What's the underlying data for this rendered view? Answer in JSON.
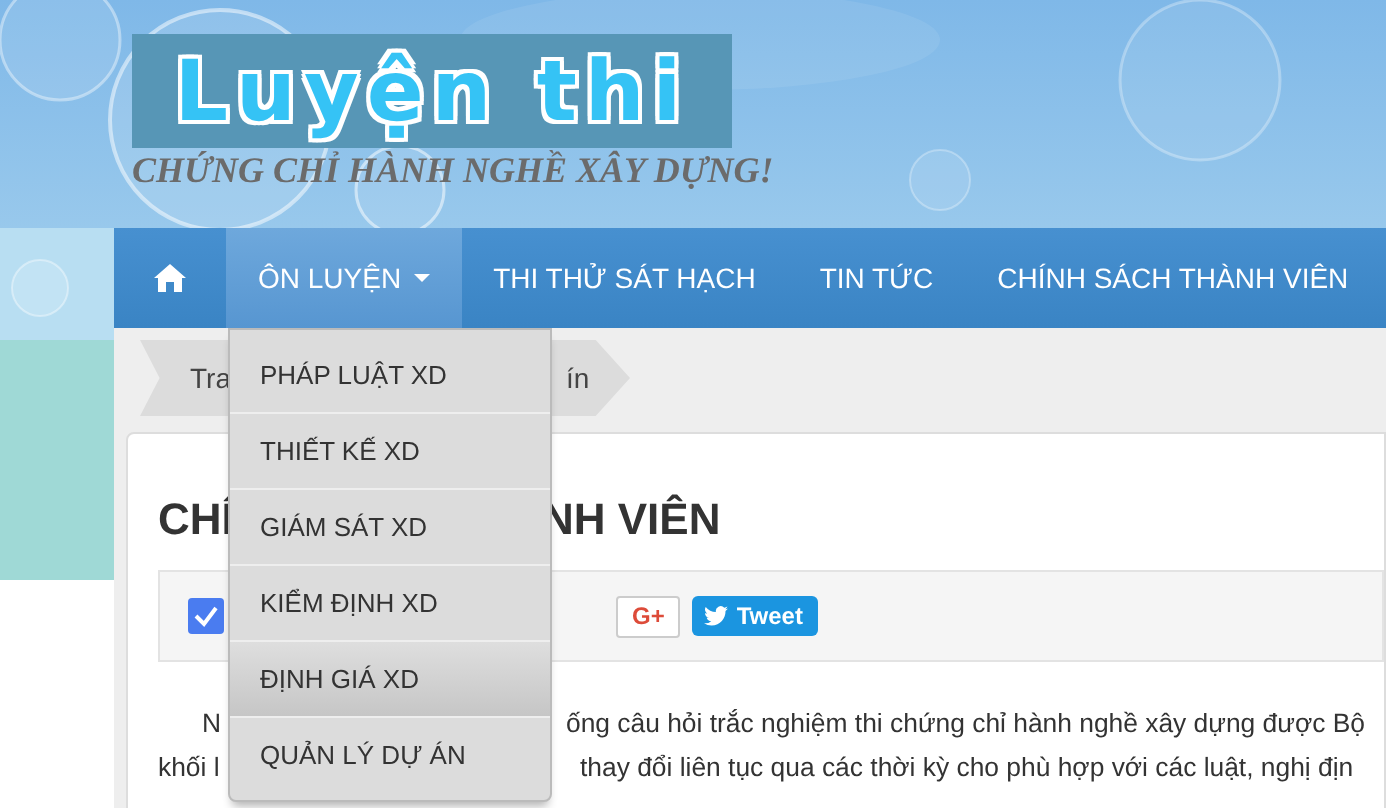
{
  "site": {
    "logo": "Luyện thi",
    "tagline": "CHỨNG CHỈ HÀNH NGHỀ XÂY DỰNG!"
  },
  "nav": {
    "items": [
      {
        "kind": "home",
        "selected": false
      },
      {
        "kind": "dropdown",
        "label": "ÔN LUYỆN",
        "selected": true
      },
      {
        "kind": "link",
        "label": "THI THỬ SÁT HẠCH",
        "selected": false
      },
      {
        "kind": "link",
        "label": "TIN TỨC",
        "selected": false
      },
      {
        "kind": "link",
        "label": "CHÍNH SÁCH THÀNH VIÊN",
        "selected": false
      }
    ]
  },
  "dropdown": {
    "items": [
      {
        "label": "PHÁP LUẬT XD",
        "selected": false
      },
      {
        "label": "THIẾT KẾ XD",
        "selected": false
      },
      {
        "label": "GIÁM SÁT XD",
        "selected": false
      },
      {
        "label": "KIỂM ĐỊNH XD",
        "selected": false
      },
      {
        "label": "ĐỊNH GIÁ XD",
        "selected": true
      },
      {
        "label": "QUẢN LÝ DỰ ÁN",
        "selected": false
      }
    ]
  },
  "breadcrumb": [
    "Tra",
    "ín"
  ],
  "article": {
    "title": [
      "CHÍ",
      "NH VIÊN"
    ],
    "share": {
      "gplus": "G+",
      "tweet": "Tweet"
    },
    "lines": [
      [
        "N",
        "ống câu hỏi trắc nghiệm thi chứng chỉ hành nghề xây dựng được Bộ"
      ],
      [
        "khối l",
        "thay đổi liên tục qua các thời kỳ cho phù hợp với các luật, nghị địn"
      ]
    ]
  }
}
